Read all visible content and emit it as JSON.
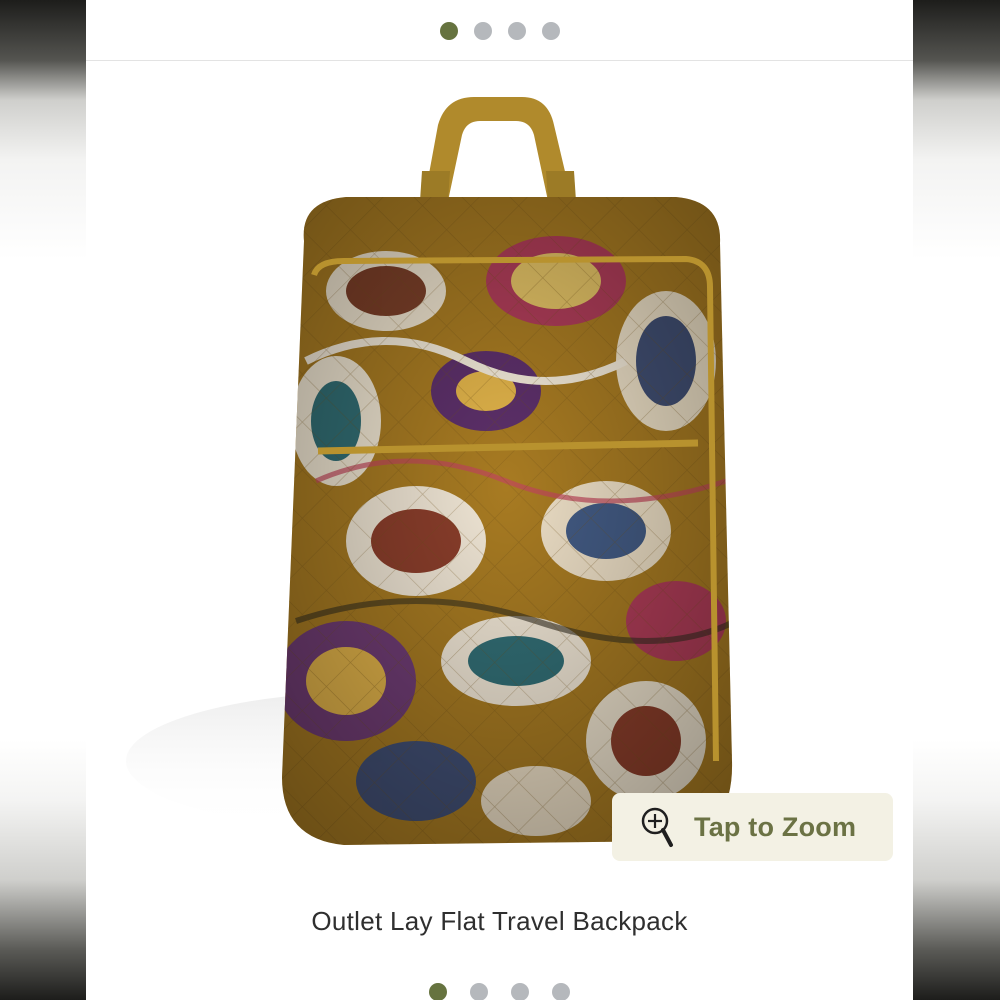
{
  "carousel": {
    "slide_count": 4,
    "active_index": 0,
    "dot_active_color": "#66733f",
    "dot_inactive_color": "#b5b8bc"
  },
  "product": {
    "image_alt": "paisley-quilted-backpack",
    "zoom_label": "Tap to Zoom",
    "zoom_icon": "magnifier-plus-icon",
    "title": "Outlet Lay Flat Travel Backpack"
  }
}
